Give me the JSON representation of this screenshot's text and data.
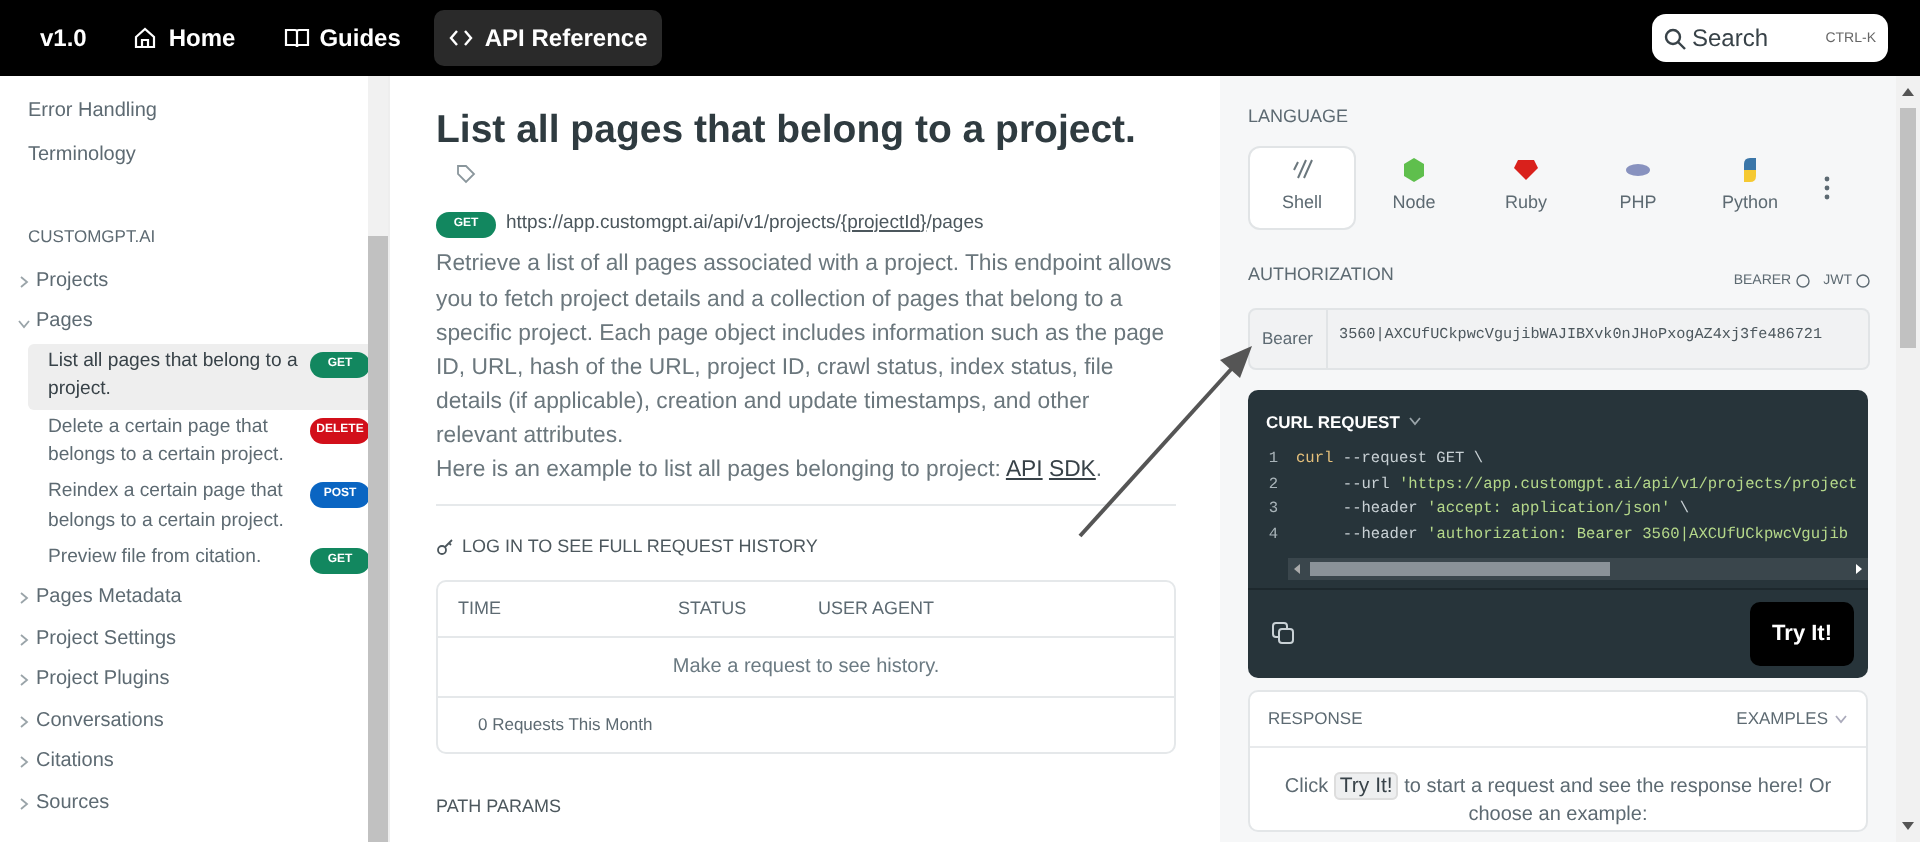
{
  "topnav": {
    "version": "v1.0",
    "links": [
      {
        "label": "Home",
        "selected": false
      },
      {
        "label": "Guides",
        "selected": false
      },
      {
        "label": "API Reference",
        "selected": true
      }
    ],
    "search": {
      "placeholder": "Search",
      "shortcut": "CTRL-K"
    }
  },
  "sidebar": {
    "top_items": [
      "Error Handling",
      "Terminology"
    ],
    "section": "CUSTOMGPT.AI",
    "groups": [
      {
        "label": "Projects",
        "expanded": false
      },
      {
        "label": "Pages",
        "expanded": true,
        "children": [
          {
            "label": "List all pages that belong to a project.",
            "method": "GET",
            "selected": true
          },
          {
            "label": "Delete a certain page that belongs to a certain project.",
            "method": "DELETE",
            "selected": false
          },
          {
            "label": "Reindex a certain page that belongs to a certain project.",
            "method": "POST",
            "selected": false
          },
          {
            "label": "Preview file from citation.",
            "method": "GET",
            "selected": false
          }
        ]
      },
      {
        "label": "Pages Metadata",
        "expanded": false
      },
      {
        "label": "Project Settings",
        "expanded": false
      },
      {
        "label": "Project Plugins",
        "expanded": false
      },
      {
        "label": "Conversations",
        "expanded": false
      },
      {
        "label": "Citations",
        "expanded": false
      },
      {
        "label": "Sources",
        "expanded": false
      }
    ]
  },
  "main": {
    "title": "List all pages that belong to a project.",
    "method": "GET",
    "url_prefix": "https://app.customgpt.ai/api/v1/projects/",
    "url_param": "{projectId}",
    "url_suffix": "/pages",
    "description": "Retrieve a list of all pages associated with a project. This endpoint allows you to fetch project details and a collection of pages that belong to a specific project. Each page object includes information such as the page ID, URL, hash of the URL, project ID, crawl status, index status, file details (if applicable), creation and update timestamps, and other relevant attributes.",
    "example_text": "Here is an example to list all pages belonging to project:",
    "example_links": [
      "API",
      "SDK"
    ],
    "example_end": ".",
    "history_title": "LOG IN TO SEE FULL REQUEST HISTORY",
    "history_columns": [
      "TIME",
      "STATUS",
      "USER AGENT"
    ],
    "history_empty": "Make a request to see history.",
    "history_footer": "0 Requests This Month",
    "path_params_title": "PATH PARAMS"
  },
  "right": {
    "language_title": "LANGUAGE",
    "languages": [
      {
        "label": "Shell",
        "selected": true
      },
      {
        "label": "Node",
        "selected": false
      },
      {
        "label": "Ruby",
        "selected": false
      },
      {
        "label": "PHP",
        "selected": false
      },
      {
        "label": "Python",
        "selected": false
      }
    ],
    "auth_title": "AUTHORIZATION",
    "auth_options": [
      "BEARER",
      "JWT"
    ],
    "auth_prefix": "Bearer",
    "auth_value": "3560|AXCUfUCkpwcVgujibWAJIBXvk0nJHoPxogAZ4xj3fe486721",
    "curl_title": "CURL REQUEST",
    "code_lines": [
      {
        "number": "1",
        "parts": [
          {
            "kind": "keyword",
            "text": "curl"
          },
          {
            "kind": "plain",
            "text": " --request GET \\"
          }
        ]
      },
      {
        "number": "2",
        "parts": [
          {
            "kind": "plain",
            "text": "     --url "
          },
          {
            "kind": "string",
            "text": "'https://app.customgpt.ai/api/v1/projects/project"
          }
        ]
      },
      {
        "number": "3",
        "parts": [
          {
            "kind": "plain",
            "text": "     --header "
          },
          {
            "kind": "string",
            "text": "'accept: application/json'"
          },
          {
            "kind": "plain",
            "text": " \\"
          }
        ]
      },
      {
        "number": "4",
        "parts": [
          {
            "kind": "plain",
            "text": "     --header "
          },
          {
            "kind": "string",
            "text": "'authorization: Bearer 3560|AXCUfUCkpwcVgujib"
          }
        ]
      }
    ],
    "try_button": "Try It!",
    "response_title": "RESPONSE",
    "examples_label": "EXAMPLES",
    "response_hint_start": "Click",
    "response_hint_button": "Try It!",
    "response_hint_end": "to start a request and see the response here! Or choose an example:"
  }
}
